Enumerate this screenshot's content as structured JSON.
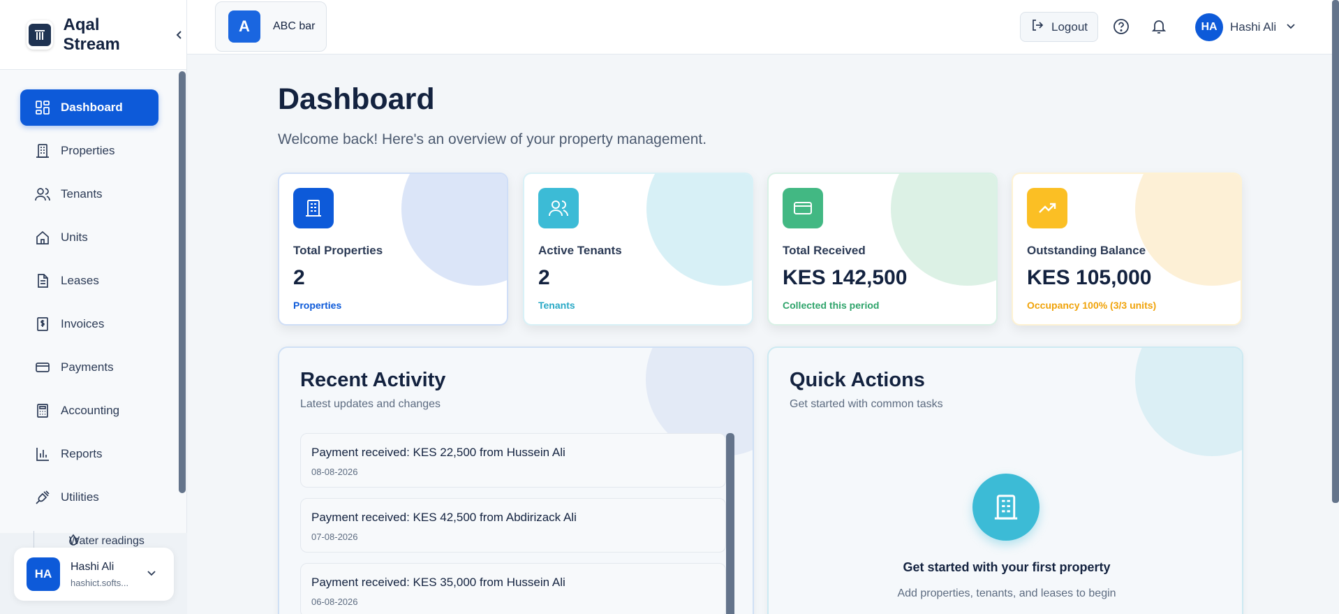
{
  "app": {
    "name": "Aqal Stream",
    "colors": {
      "primary": "#0d5ad9",
      "cyan": "#3cbbd6",
      "green": "#42b883",
      "amber": "#fbbf24"
    }
  },
  "sidebar": {
    "items": [
      {
        "label": "Dashboard",
        "icon": "dashboard-icon",
        "active": true
      },
      {
        "label": "Properties",
        "icon": "building-icon"
      },
      {
        "label": "Tenants",
        "icon": "users-icon"
      },
      {
        "label": "Units",
        "icon": "home-icon"
      },
      {
        "label": "Leases",
        "icon": "document-icon"
      },
      {
        "label": "Invoices",
        "icon": "invoice-icon"
      },
      {
        "label": "Payments",
        "icon": "credit-card-icon"
      },
      {
        "label": "Accounting",
        "icon": "calculator-icon"
      },
      {
        "label": "Reports",
        "icon": "bar-chart-icon"
      },
      {
        "label": "Utilities",
        "icon": "plug-icon"
      }
    ],
    "sub_item": {
      "label": "Water readings",
      "icon": "droplet-icon"
    },
    "user": {
      "initials": "HA",
      "name": "Hashi Ali",
      "email": "hashict.softs..."
    }
  },
  "topbar": {
    "org": {
      "initial": "A",
      "name": "ABC bar"
    },
    "logout_label": "Logout",
    "user": {
      "initials": "HA",
      "name": "Hashi Ali"
    }
  },
  "main": {
    "title": "Dashboard",
    "subtitle": "Welcome back! Here's an overview of your property management.",
    "stats": [
      {
        "label": "Total Properties",
        "value": "2",
        "note": "Properties",
        "color": "#0d5ad9",
        "note_color": "#0d5ad9"
      },
      {
        "label": "Active Tenants",
        "value": "2",
        "note": "Tenants",
        "color": "#3cbbd6",
        "note_color": "#2aa9c6"
      },
      {
        "label": "Total Received",
        "value": "KES 142,500",
        "note": "Collected this period",
        "color": "#42b883",
        "note_color": "#2fa46b"
      },
      {
        "label": "Outstanding Balance",
        "value": "KES 105,000",
        "note": "Occupancy 100% (3/3 units)",
        "color": "#fbbf24",
        "note_color": "#f0a30a"
      }
    ],
    "recent_activity": {
      "title": "Recent Activity",
      "subtitle": "Latest updates and changes",
      "items": [
        {
          "text": "Payment received: KES 22,500 from Hussein Ali",
          "date": "08-08-2026"
        },
        {
          "text": "Payment received: KES 42,500 from Abdirizack Ali",
          "date": "07-08-2026"
        },
        {
          "text": "Payment received: KES 35,000 from Hussein Ali",
          "date": "06-08-2026"
        }
      ]
    },
    "quick_actions": {
      "title": "Quick Actions",
      "subtitle": "Get started with common tasks",
      "heading": "Get started with your first property",
      "text": "Add properties, tenants, and leases to begin"
    }
  }
}
